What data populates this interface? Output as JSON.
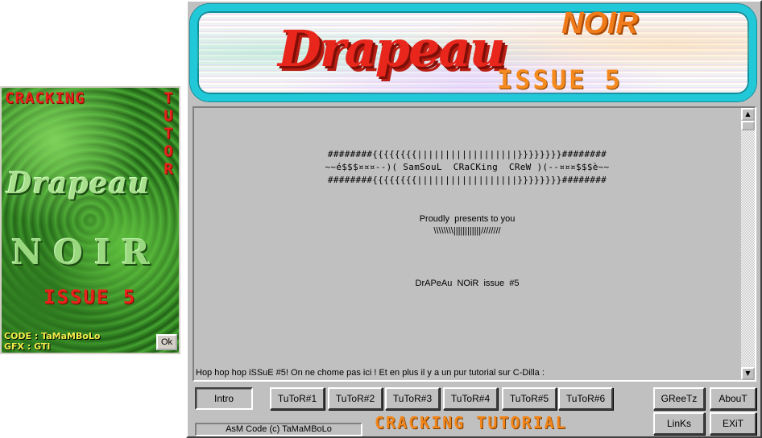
{
  "splash": {
    "title_top": "CRACKING",
    "title_side": "TUTOR",
    "logo_main": "Drapeau",
    "logo_noir": "NOIR",
    "issue": "ISSUE 5",
    "credit_code": "CODE : TaMaMBoLo",
    "credit_gfx": "GFX : GTI",
    "ok_label": "Ok"
  },
  "banner": {
    "logo_main": "Drapeau",
    "logo_noir": "NOIR",
    "issue": "ISSUE 5"
  },
  "text": {
    "lines": [
      "########{{{{{{{{||||||||||||||||||}}}}}}}}########",
      "~~é$$$¤¤¤--)( SamSouL  CRaCKing  CReW )(--¤¤¤$$$è~~",
      "########{{{{{{{{||||||||||||||||||}}}}}}}}########",
      "Proudly  presents to you",
      "\\\\\\\\\\\\\\\\||||||||||||////////",
      "DrAPeAu  NOiR  issue  #5",
      "Hop hop hop iSSuE #5! On ne chome pas ici ! Et en plus il y a un pur tutorial sur C-Dilla :"
    ]
  },
  "buttons": {
    "intro": "Intro",
    "tutors": [
      "TuToR#1",
      "TuToR#2",
      "TuToR#3",
      "TuToR#4",
      "TuToR#5",
      "TuToR#6"
    ],
    "greetz": "GReeTz",
    "about": "AbouT",
    "links": "LinKs",
    "exit": "EXiT"
  },
  "status": "AsM Code (c) TaMaMBoLo",
  "footer_logo": "CRACKING TUTORIAL",
  "colors": {
    "accent_red": "#e8221a",
    "accent_orange": "#f2861a",
    "banner_frame": "#20c8d8",
    "window_gray": "#c0c0c0"
  }
}
